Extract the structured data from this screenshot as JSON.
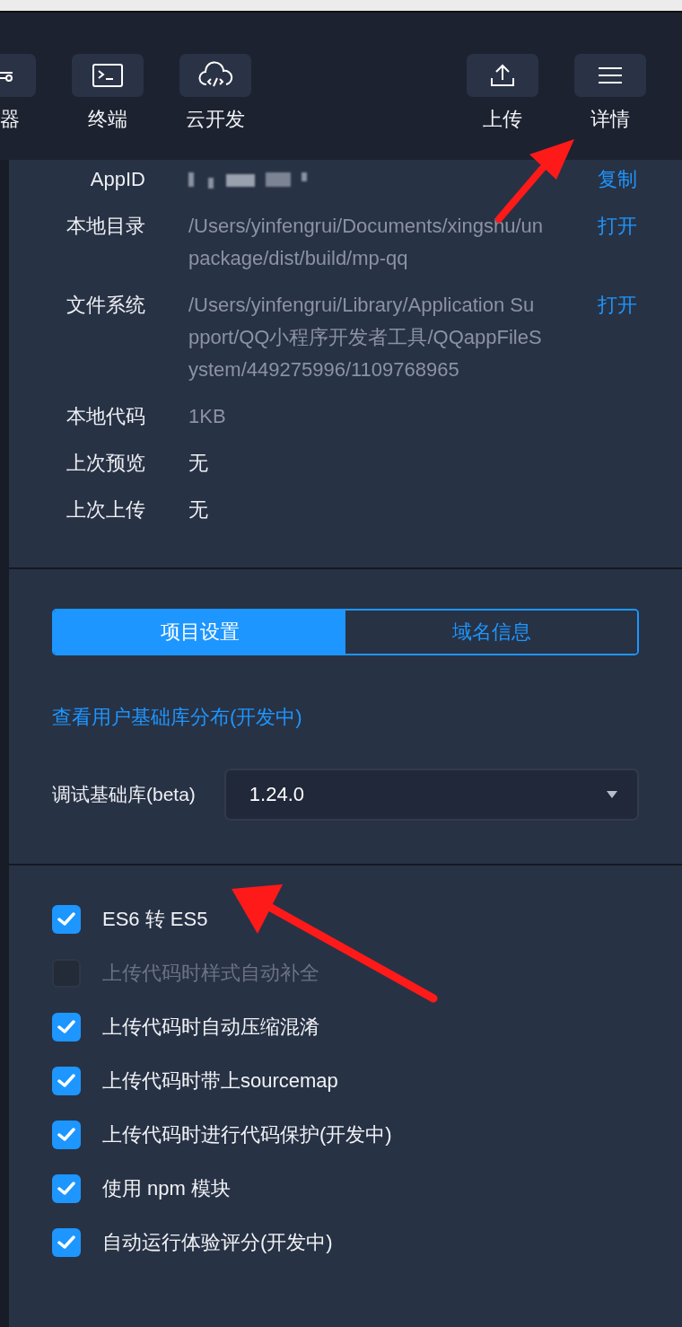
{
  "toolbar": {
    "left": [
      {
        "label": "器"
      },
      {
        "label": "终端"
      },
      {
        "label": "云开发"
      }
    ],
    "right": [
      {
        "label": "上传"
      },
      {
        "label": "详情"
      }
    ]
  },
  "info": [
    {
      "label": "AppID",
      "kind": "blurred",
      "action": "复制"
    },
    {
      "label": "本地目录",
      "kind": "text",
      "value": "/Users/yinfengrui/Documents/xingshu/unpackage/dist/build/mp-qq",
      "action": "打开"
    },
    {
      "label": "文件系统",
      "kind": "text",
      "value": "/Users/yinfengrui/Library/Application Support/QQ小程序开发者工具/QQappFileSystem/449275996/1109768965",
      "action": "打开"
    },
    {
      "label": "本地代码",
      "kind": "text",
      "value": "1KB"
    },
    {
      "label": "上次预览",
      "kind": "plain",
      "value": "无"
    },
    {
      "label": "上次上传",
      "kind": "plain",
      "value": "无"
    }
  ],
  "tabs": [
    {
      "label": "项目设置",
      "selected": true
    },
    {
      "label": "域名信息",
      "selected": false
    }
  ],
  "distribution_link": "查看用户基础库分布(开发中)",
  "library": {
    "label": "调试基础库(beta)",
    "value": "1.24.0"
  },
  "options": [
    {
      "label": "ES6 转 ES5",
      "checked": true,
      "disabled": false
    },
    {
      "label": "上传代码时样式自动补全",
      "checked": false,
      "disabled": true
    },
    {
      "label": "上传代码时自动压缩混淆",
      "checked": true,
      "disabled": false
    },
    {
      "label": "上传代码时带上sourcemap",
      "checked": true,
      "disabled": false
    },
    {
      "label": "上传代码时进行代码保护(开发中)",
      "checked": true,
      "disabled": false
    },
    {
      "label": "使用 npm 模块",
      "checked": true,
      "disabled": false
    },
    {
      "label": "自动运行体验评分(开发中)",
      "checked": true,
      "disabled": false
    }
  ]
}
